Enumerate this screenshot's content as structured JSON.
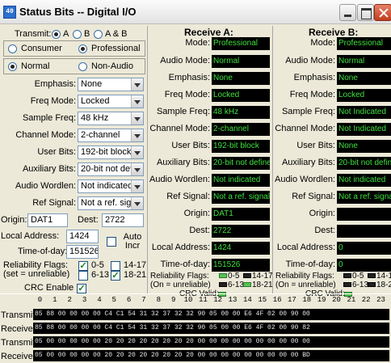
{
  "window": {
    "title": "Status Bits -- Digital I/O",
    "icon_text": "40"
  },
  "transmit": {
    "label": "Transmit:",
    "channel_options": [
      "A",
      "B",
      "A & B"
    ],
    "channel_selected": "A",
    "consumer_label": "Consumer",
    "professional_label": "Professional",
    "mode_selected": "Professional",
    "normal_label": "Normal",
    "nonaudio_label": "Non-Audio",
    "audio_selected": "Normal",
    "fields": [
      {
        "label": "Emphasis:",
        "value": "None"
      },
      {
        "label": "Freq Mode:",
        "value": "Locked"
      },
      {
        "label": "Sample Freq:",
        "value": "48 kHz"
      },
      {
        "label": "Channel Mode:",
        "value": "2-channel"
      },
      {
        "label": "User Bits:",
        "value": "192-bit block"
      },
      {
        "label": "Auxiliary Bits:",
        "value": "20-bit not def"
      },
      {
        "label": "Audio Wordlen:",
        "value": "Not indicated"
      },
      {
        "label": "Ref Signal:",
        "value": "Not a ref. sign"
      }
    ],
    "origin_label": "Origin:",
    "origin_value": "DAT1",
    "dest_label": "Dest:",
    "dest_value": "2722",
    "local_address_label": "Local Address:",
    "local_address_value": "1424",
    "time_of_day_label": "Time-of-day:",
    "time_of_day_value": "151526",
    "auto_incr_label": "Auto Incr",
    "auto_incr_checked": false,
    "reliability_label": "Reliability Flags:",
    "reliability_sub": "(set = unreliable)",
    "flag_05": "0-5",
    "flag_0513": "6-13",
    "flag_1417": "14-17",
    "flag_1821": "18-21",
    "flag_05_checked": true,
    "flag_613_checked": false,
    "flag_1417_checked": false,
    "flag_1821_checked": true,
    "crc_label": "CRC Enable",
    "crc_checked": true
  },
  "receive_a": {
    "header": "Receive A:",
    "mode_label": "Mode:",
    "mode": "Professional",
    "fields": [
      {
        "label": "Audio Mode:",
        "value": "Normal"
      },
      {
        "label": "Emphasis:",
        "value": "None"
      },
      {
        "label": "Freq Mode:",
        "value": "Locked"
      },
      {
        "label": "Sample Freq:",
        "value": "48 kHz"
      },
      {
        "label": "Channel Mode:",
        "value": "2-channel"
      },
      {
        "label": "User Bits:",
        "value": "192-bit block"
      },
      {
        "label": "Auxiliary Bits:",
        "value": "20-bit not define"
      },
      {
        "label": "Audio Wordlen:",
        "value": "Not indicated"
      },
      {
        "label": "Ref Signal:",
        "value": "Not a ref. signal"
      },
      {
        "label": "Origin:",
        "value": "DAT1"
      },
      {
        "label": "Dest:",
        "value": "2722"
      }
    ],
    "local_address_label": "Local Address:",
    "local_address": "1424",
    "time_of_day_label": "Time-of-day:",
    "time_of_day": "151526",
    "reliability_label": "Reliability Flags:",
    "reliability_sub": "(On = unreliable)",
    "flags": [
      "0-5",
      "14-17",
      "6-13",
      "18-21"
    ],
    "crc_label": "CRC Valid:"
  },
  "receive_b": {
    "header": "Receive B:",
    "mode_label": "Mode:",
    "mode": "Professional",
    "fields": [
      {
        "label": "Audio Mode:",
        "value": "Normal"
      },
      {
        "label": "Emphasis:",
        "value": "None"
      },
      {
        "label": "Freq Mode:",
        "value": "Locked"
      },
      {
        "label": "Sample Freq:",
        "value": "Not Indicated"
      },
      {
        "label": "Channel Mode:",
        "value": "Not Indicated"
      },
      {
        "label": "User Bits:",
        "value": "None"
      },
      {
        "label": "Auxiliary Bits:",
        "value": "20-bit not define"
      },
      {
        "label": "Audio Wordlen:",
        "value": "Not indicated"
      },
      {
        "label": "Ref Signal:",
        "value": "Not a ref. signa"
      },
      {
        "label": "Origin:",
        "value": ""
      },
      {
        "label": "Dest:",
        "value": ""
      }
    ],
    "local_address_label": "Local Address:",
    "local_address": "0",
    "time_of_day_label": "Time-of-day:",
    "time_of_day": "0",
    "reliability_label": "Reliability Flags:",
    "reliability_sub": "(On = unreliable)",
    "flags": [
      "0-5",
      "14-1",
      "6-13",
      "18-2"
    ],
    "crc_label": "CRC Valid:"
  },
  "hex": {
    "byte_indices": [
      "0",
      "1",
      "2",
      "3",
      "4",
      "5",
      "6",
      "7",
      "8",
      "9",
      "10",
      "11",
      "12",
      "13",
      "14",
      "15",
      "16",
      "17",
      "18",
      "19",
      "20",
      "21",
      "22",
      "23"
    ],
    "rows": [
      {
        "label": "Transmit A:",
        "bytes": "85 88 00 00 00 00 C4 C1 54 31 32 37 32 32 90 05 00 00 E6 4F 02 00 90 00"
      },
      {
        "label": "Receive A:",
        "bytes": "85 88 00 00 00 00 C4 C1 54 31 32 37 32 32 90 05 00 00 E6 4F 02 00 90 82"
      },
      {
        "label": "Transmit B:",
        "bytes": "05 00 00 00 00 00 20 20 20 20 20 20 20 20 00 00 00 00 00 00 00 00 00 00"
      },
      {
        "label": "Receive B:",
        "bytes": "05 00 00 00 00 00 20 20 20 20 20 20 20 20 00 00 00 00 00 00 00 00 00 BD"
      }
    ]
  }
}
